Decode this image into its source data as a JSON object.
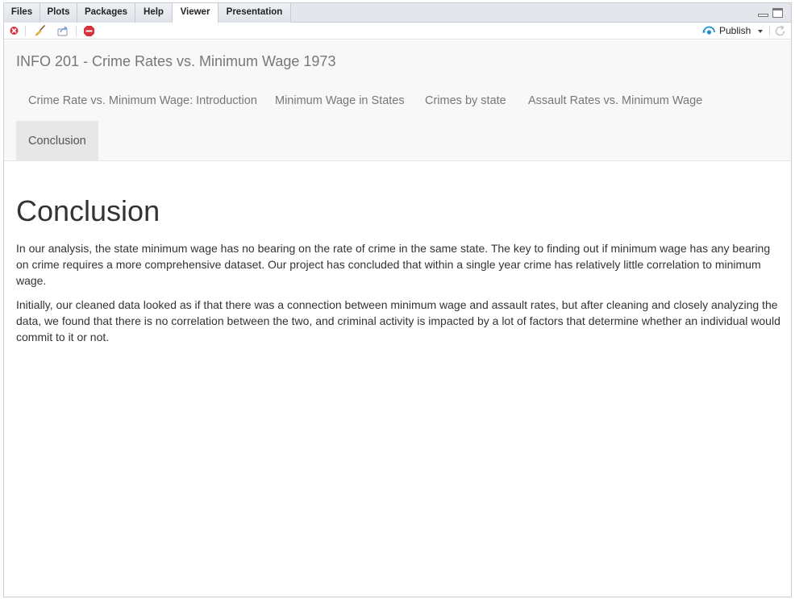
{
  "tabs": [
    {
      "label": "Files",
      "active": false
    },
    {
      "label": "Plots",
      "active": false
    },
    {
      "label": "Packages",
      "active": false
    },
    {
      "label": "Help",
      "active": false
    },
    {
      "label": "Viewer",
      "active": true
    },
    {
      "label": "Presentation",
      "active": false
    }
  ],
  "toolbar": {
    "icons": [
      "clear-viewer-icon",
      "broom-icon",
      "export-icon",
      "stop-icon"
    ],
    "publish_label": "Publish"
  },
  "app": {
    "brand": "INFO 201 - Crime Rates vs. Minimum Wage 1973",
    "nav": [
      {
        "label": "Crime Rate vs. Minimum Wage: Introduction",
        "active": false
      },
      {
        "label": "Minimum Wage in States",
        "active": false
      },
      {
        "label": "Crimes by state",
        "active": false
      },
      {
        "label": "Assault Rates vs. Minimum Wage",
        "active": false
      },
      {
        "label": "Conclusion",
        "active": true
      }
    ]
  },
  "content": {
    "heading": "Conclusion",
    "paragraphs": [
      "In our analysis, the state minimum wage has no bearing on the rate of crime in the same state. The key to finding out if minimum wage has any bearing on crime requires a more comprehensive dataset. Our project has concluded that within a single year crime has relatively little correlation to minimum wage.",
      "Initially, our cleaned data looked as if that there was a connection between minimum wage and assault rates, but after cleaning and closely analyzing the data, we found that there is no correlation between the two, and criminal activity is impacted by a lot of factors that determine whether an individual would commit to it or not."
    ]
  },
  "colors": {
    "accent_publish": "#1a8fd1",
    "stop_red": "#d9303a"
  }
}
